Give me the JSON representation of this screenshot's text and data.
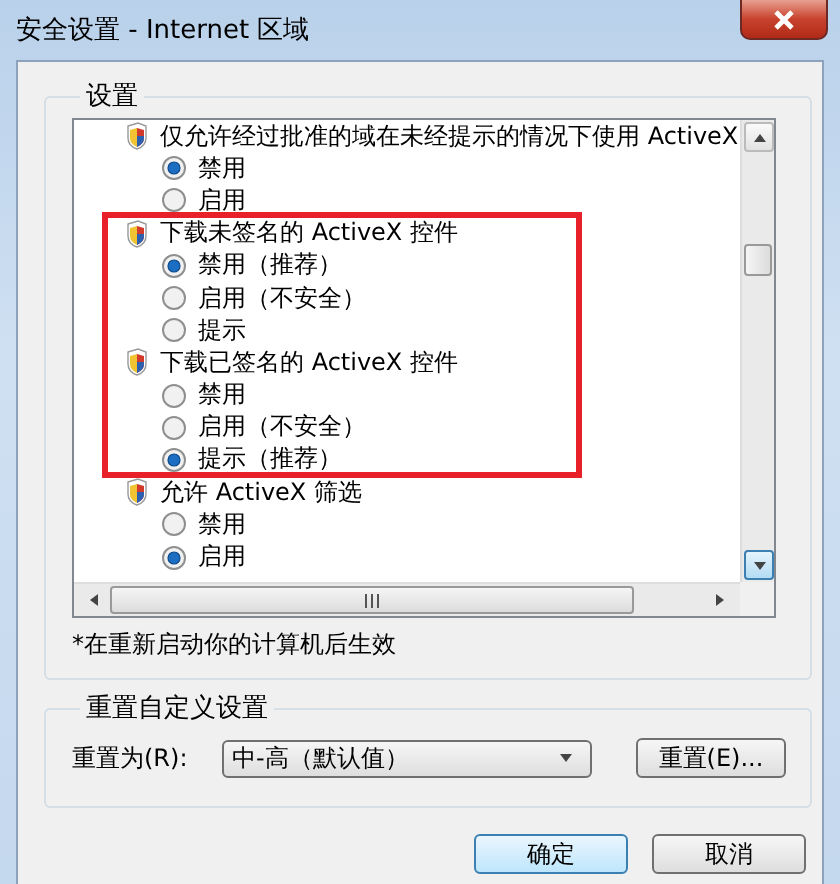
{
  "window": {
    "title": "安全设置 - Internet 区域"
  },
  "settings_group": {
    "title": "设置",
    "items": [
      {
        "label": "仅允许经过批准的域在未经提示的情况下使用 ActiveX",
        "options": [
          {
            "label": "禁用",
            "selected": true
          },
          {
            "label": "启用",
            "selected": false
          }
        ]
      },
      {
        "label": "下载未签名的 ActiveX 控件",
        "options": [
          {
            "label": "禁用（推荐）",
            "selected": true
          },
          {
            "label": "启用（不安全）",
            "selected": false
          },
          {
            "label": "提示",
            "selected": false
          }
        ]
      },
      {
        "label": "下载已签名的 ActiveX 控件",
        "options": [
          {
            "label": "禁用",
            "selected": false
          },
          {
            "label": "启用（不安全）",
            "selected": false
          },
          {
            "label": "提示（推荐）",
            "selected": true
          }
        ]
      },
      {
        "label": "允许 ActiveX 筛选",
        "options": [
          {
            "label": "禁用",
            "selected": false
          },
          {
            "label": "启用",
            "selected": true
          }
        ]
      }
    ],
    "note": "*在重新启动你的计算机后生效"
  },
  "reset_group": {
    "title": "重置自定义设置",
    "label": "重置为(R):",
    "value": "中-高（默认值）",
    "button": "重置(E)..."
  },
  "buttons": [
    "确定",
    "取消"
  ]
}
